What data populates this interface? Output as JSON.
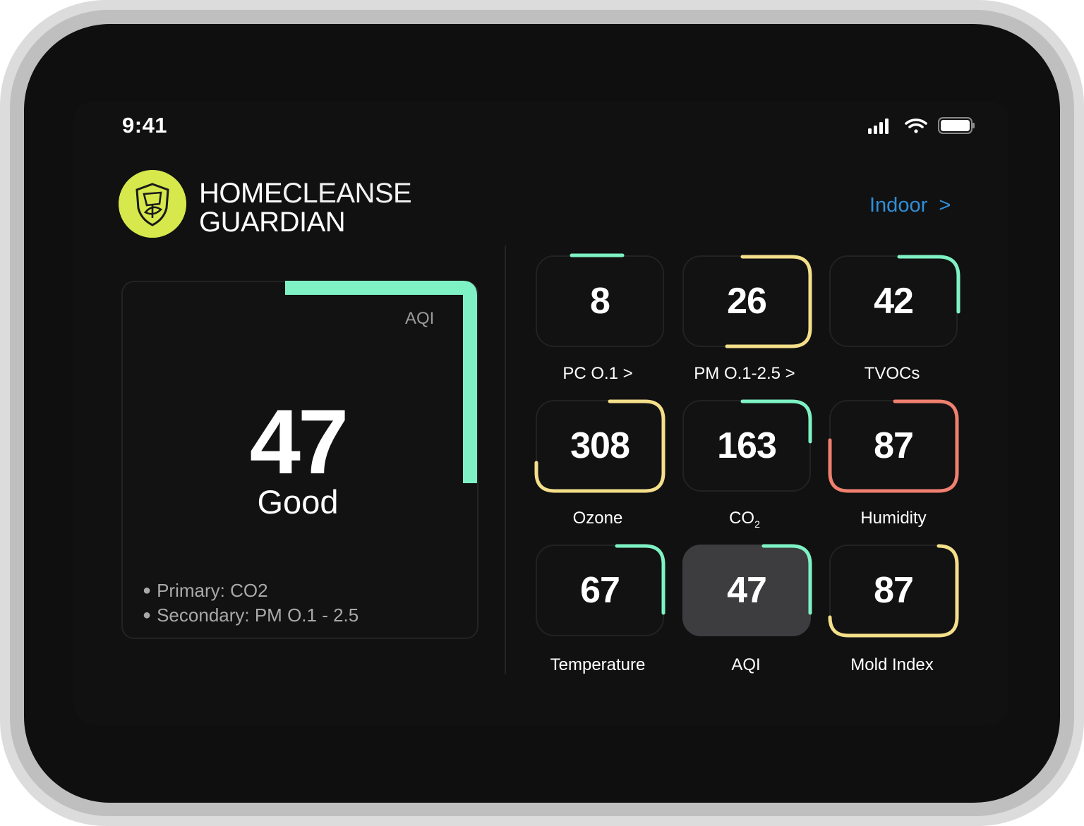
{
  "status_bar": {
    "time": "9:41",
    "signal_icon": "cellular-signal-icon",
    "wifi_icon": "wifi-icon",
    "battery_icon": "battery-icon"
  },
  "brand": {
    "line1_a": "HOME",
    "line1_b": "CLEANSE",
    "line2": "GUARDIAN",
    "logo_icon": "shield-leaf-icon",
    "logo_color": "#d6e84b"
  },
  "location": {
    "label": "Indoor",
    "chevron": ">",
    "color": "#2f8fd8"
  },
  "aqi_panel": {
    "label": "AQI",
    "value": "47",
    "status": "Good",
    "accent_color": "#7ef2c4",
    "primary": "Primary: CO2",
    "secondary": "Secondary:  PM O.1 - 2.5"
  },
  "colors": {
    "good": "#7ef2c4",
    "moderate": "#f4df8a",
    "poor": "#f08070"
  },
  "tiles": [
    {
      "value": "8",
      "label": "PC O.1 >",
      "level": "good"
    },
    {
      "value": "26",
      "label": "PM O.1-2.5 >",
      "level": "moderate"
    },
    {
      "value": "42",
      "label": "TVOCs",
      "level": "good"
    },
    {
      "value": "308",
      "label": "Ozone",
      "level": "moderate"
    },
    {
      "value": "163",
      "label_main": "CO",
      "label_sub": "2",
      "level": "good"
    },
    {
      "value": "87",
      "label": "Humidity",
      "level": "poor"
    },
    {
      "value": "67",
      "label": "Temperature",
      "level": "good"
    },
    {
      "value": "47",
      "label": "AQI",
      "level": "good",
      "selected": true
    },
    {
      "value": "87",
      "label": "Mold Index",
      "level": "moderate"
    }
  ]
}
